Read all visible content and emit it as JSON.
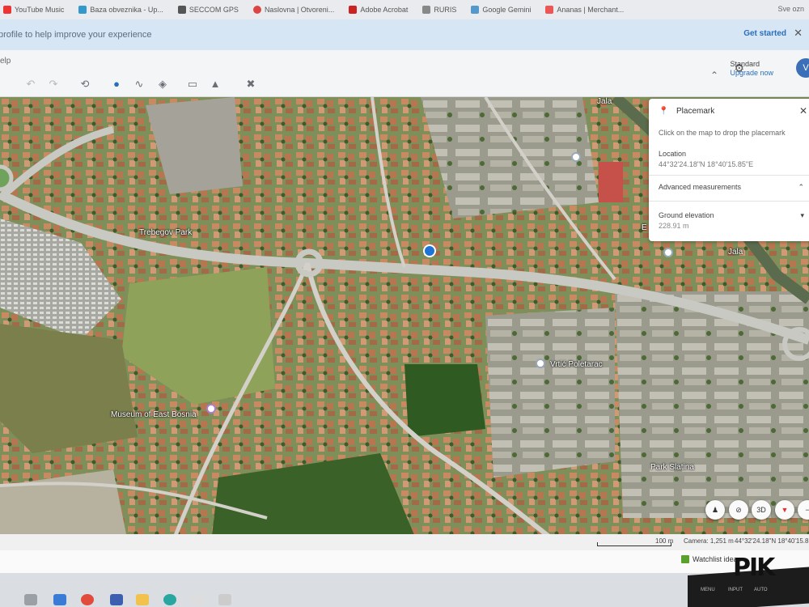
{
  "bookmarks": [
    "YouTube Music",
    "Baza obveznika - Up...",
    "SECCOM GPS",
    "Naslovna | Otvoreni...",
    "Adobe Acrobat",
    "RURIS",
    "Google Gemini",
    "Ananas | Merchant..."
  ],
  "bookmarks_right": "Sve ozn",
  "infobar": {
    "message": "profile to help improve your experience",
    "cta": "Get started"
  },
  "toolbar": {
    "help": "elp",
    "plan_title": "Standard",
    "plan_sub": "Upgrade now",
    "avatar": "V"
  },
  "map_labels": {
    "park1": "Trebegov Park",
    "museum": "Museum of East Bosnia",
    "vrtic": "Vrtić Poletarac",
    "park2": "Park Slatina",
    "jala1": "Jala",
    "jala2": "Jala",
    "partial": "E"
  },
  "placemark": {
    "title": "Placemark",
    "hint": "Click on the map to drop the placemark",
    "location_label": "Location",
    "location_value": "44°32'24.18\"N 18°40'15.85\"E",
    "advanced": "Advanced measurements",
    "elevation_label": "Ground elevation",
    "elevation_value": "228.91 m"
  },
  "controls": {
    "three_d": "3D"
  },
  "status": {
    "scale": "100 m",
    "camera": "Camera: 1,251 m",
    "coords": "44°32'24.18\"N 18°40'15.85\"E"
  },
  "lower": {
    "watchlist": "Watchlist ideas"
  },
  "bezel": {
    "b1": "MENU",
    "b2": "INPUT",
    "b3": "AUTO"
  },
  "watermark": "PIK",
  "colors": {
    "accent": "#2a6fb8",
    "infobar": "#d6e6f5",
    "map_base": "#8f9a6c",
    "roofs": "#c98a62"
  }
}
